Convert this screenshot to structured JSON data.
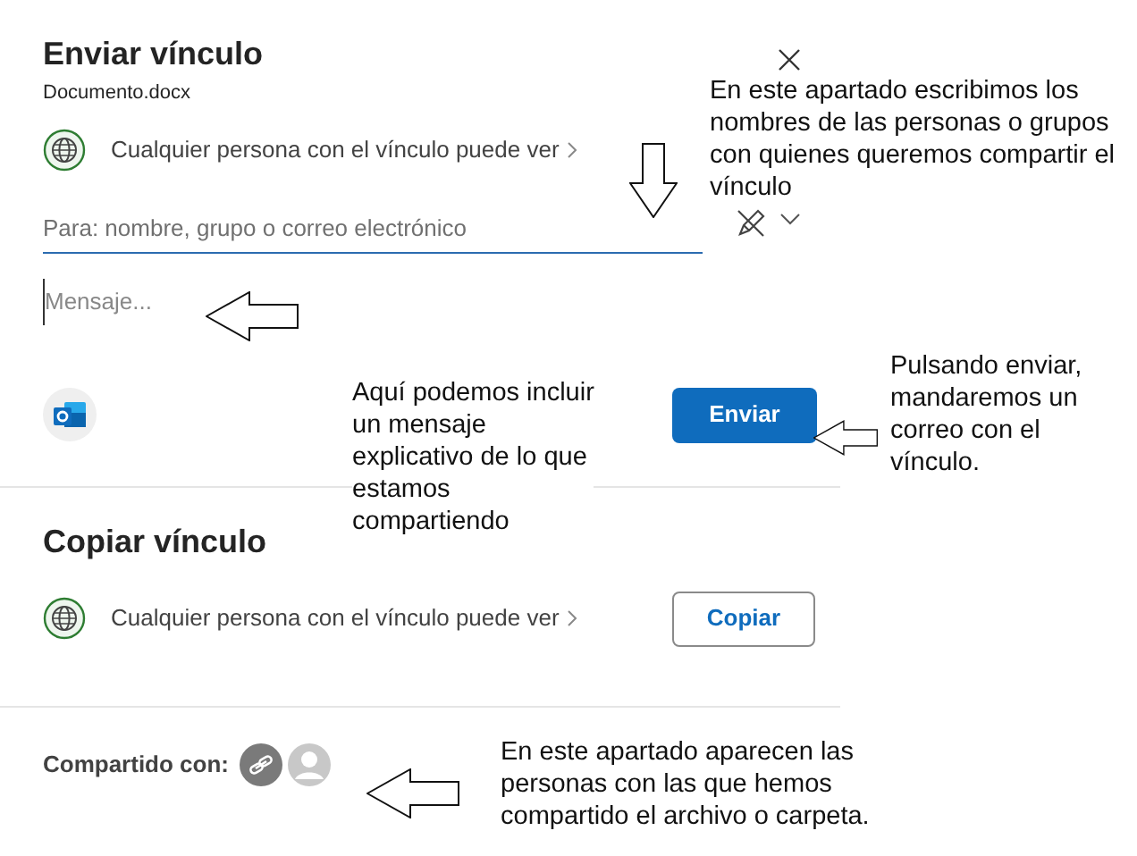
{
  "send_link": {
    "title": "Enviar vínculo",
    "file_name": "Documento.docx",
    "permission": "Cualquier persona con el vínculo puede ver",
    "to_field": {
      "placeholder": "Para: nombre, grupo o correo electrónico"
    },
    "message_field": {
      "placeholder": "Mensaje..."
    },
    "send_button": "Enviar"
  },
  "copy_link": {
    "title": "Copiar vínculo",
    "permission": "Cualquier persona con el vínculo puede ver",
    "copy_button": "Copiar"
  },
  "shared_with": {
    "label": "Compartido con:"
  },
  "annotations": [
    {
      "lines": [
        "En este apartado escribimos los",
        "nombres de las personas o grupos",
        "con quienes queremos compartir el",
        "vínculo"
      ]
    },
    {
      "lines": [
        "Aquí podemos incluir",
        "un mensaje",
        "explicativo de lo que",
        "estamos",
        "compartiendo"
      ]
    },
    {
      "lines": [
        "Pulsando enviar,",
        "mandaremos un",
        "correo con el",
        "vínculo."
      ]
    },
    {
      "lines": [
        "En este apartado aparecen las",
        "personas con las que hemos",
        "compartido el archivo o carpeta."
      ]
    }
  ]
}
